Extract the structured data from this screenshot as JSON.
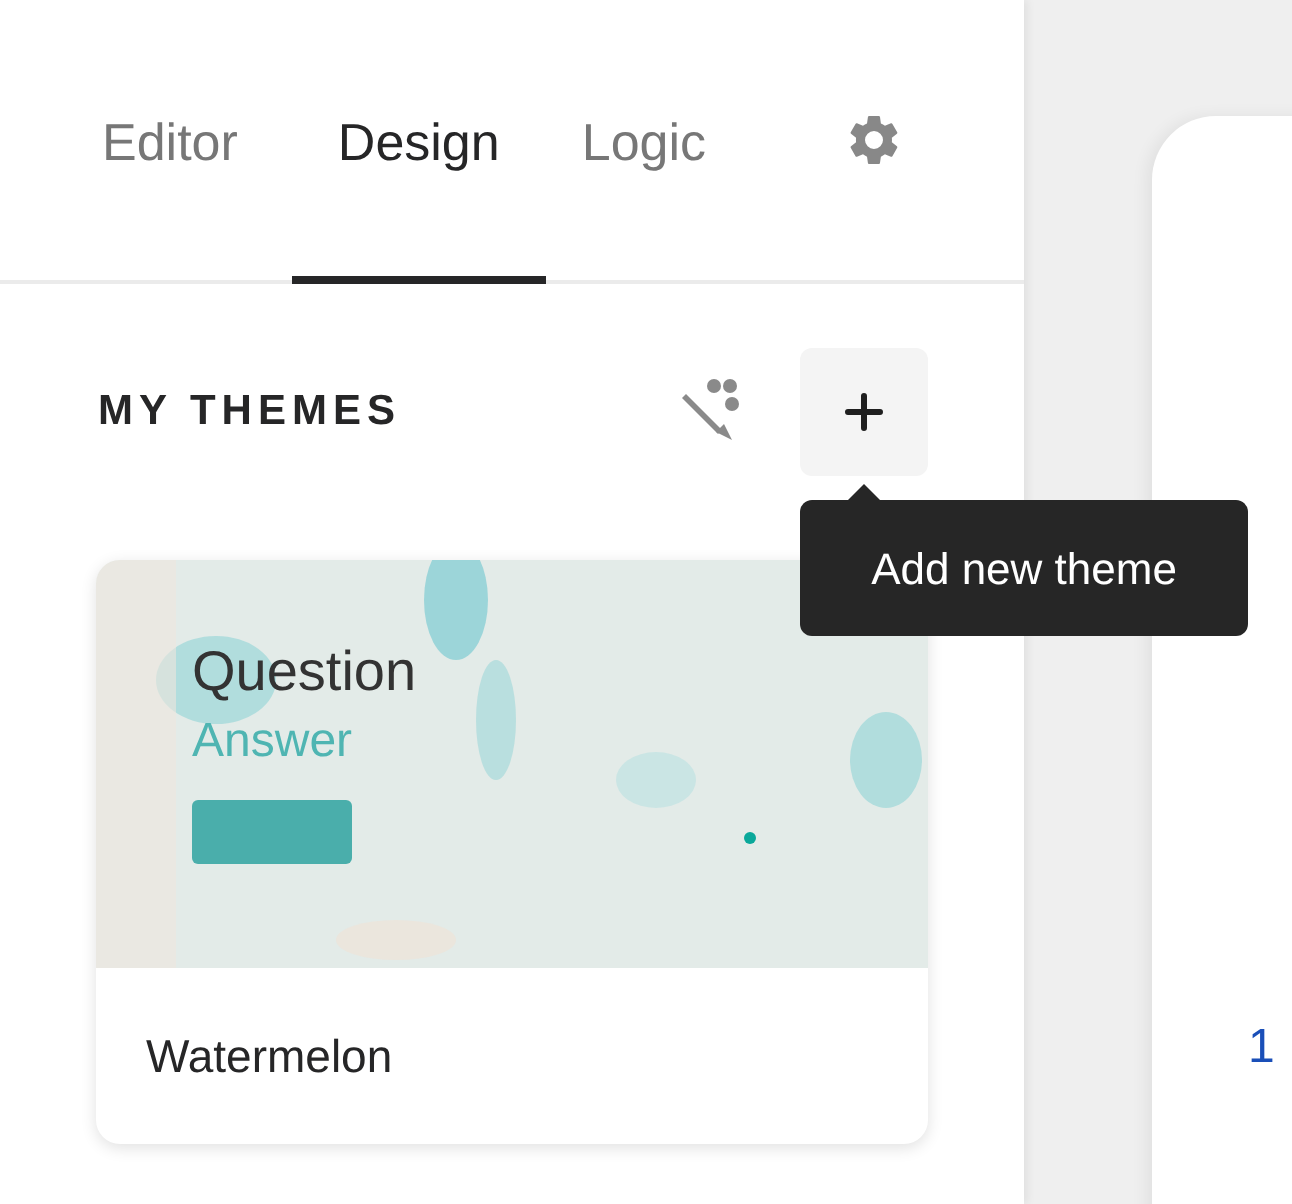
{
  "tabs": [
    {
      "label": "Editor",
      "selected": false
    },
    {
      "label": "Design",
      "selected": true
    },
    {
      "label": "Logic",
      "selected": false
    }
  ],
  "section_title": "MY THEMES",
  "tooltip": "Add new theme",
  "themes": [
    {
      "name": "Watermelon",
      "preview": {
        "question": "Question",
        "answer": "Answer"
      }
    }
  ],
  "preview_panel": {
    "text": "1"
  }
}
